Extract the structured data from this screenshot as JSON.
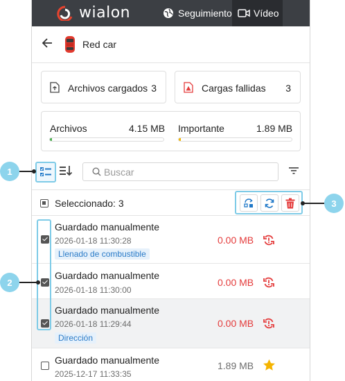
{
  "app": {
    "brand": "wialon"
  },
  "nav": {
    "tracking": "Seguimiento",
    "video": "Vídeo"
  },
  "header": {
    "unit_name": "Red car"
  },
  "stats": {
    "uploaded_label": "Archivos cargados",
    "uploaded_count": "3",
    "failed_label": "Cargas fallidas",
    "failed_count": "3"
  },
  "storage": {
    "files_label": "Archivos",
    "files_value": "4.15 MB",
    "files_fill": 0.02,
    "files_color": "#4caf50",
    "important_label": "Importante",
    "important_value": "1.89 MB",
    "important_fill": 0.02,
    "important_color": "#f2b705"
  },
  "search": {
    "placeholder": "Buscar",
    "value": ""
  },
  "selection": {
    "label": "Seleccionado: 3"
  },
  "colors": {
    "accent": "#7ecbe7",
    "danger": "#e43b3b",
    "star": "#f5b400"
  },
  "items": [
    {
      "title": "Guardado manualmente",
      "date": "2026-01-18 11:30:28",
      "tag": "Llenado de combustible",
      "size": "0.00 MB",
      "checked": true,
      "status": "failed"
    },
    {
      "title": "Guardado manualmente",
      "date": "2026-01-18 11:30:00",
      "tag": "",
      "size": "0.00 MB",
      "checked": true,
      "status": "failed"
    },
    {
      "title": "Guardado manualmente",
      "date": "2026-01-18 11:29:44",
      "tag": "Dirección",
      "size": "0.00 MB",
      "checked": true,
      "status": "failed"
    },
    {
      "title": "Guardado manualmente",
      "date": "2025-12-17 11:33:35",
      "tag": "",
      "size": "1.89 MB",
      "checked": false,
      "status": "important"
    }
  ],
  "callouts": [
    "1",
    "2",
    "3"
  ]
}
